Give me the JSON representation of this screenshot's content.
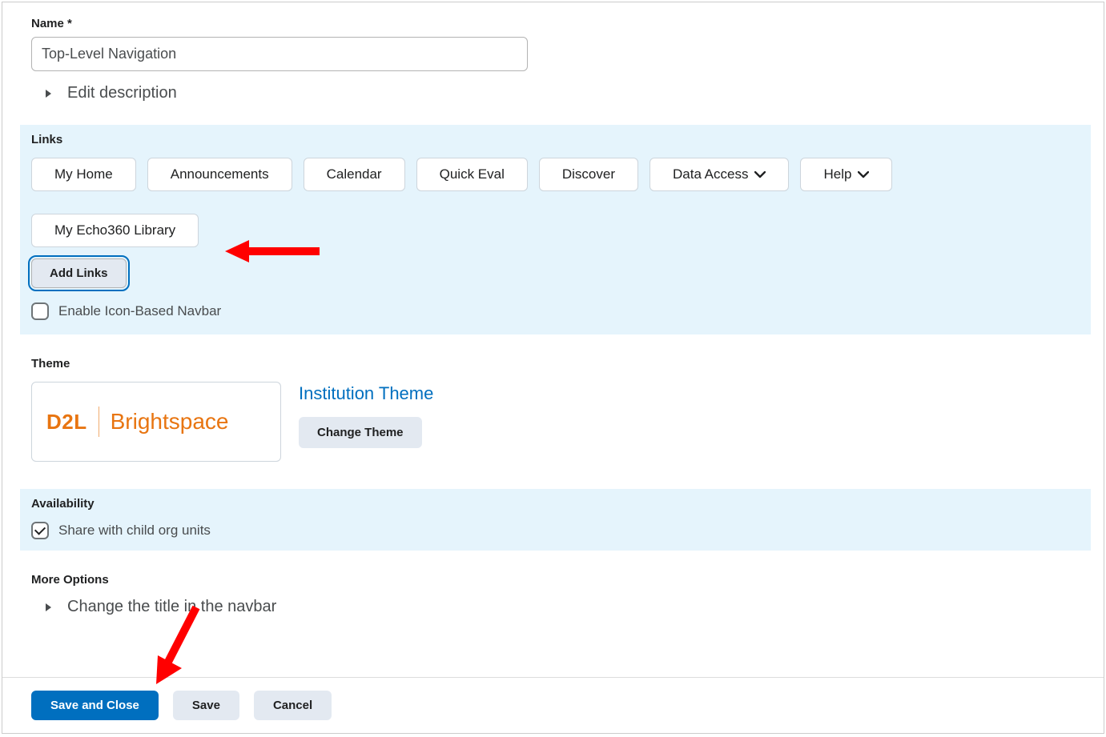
{
  "name": {
    "label": "Name *",
    "value": "Top-Level Navigation"
  },
  "editDescription": "Edit description",
  "links": {
    "heading": "Links",
    "items": [
      {
        "label": "My Home",
        "hasDropdown": false
      },
      {
        "label": "Announcements",
        "hasDropdown": false
      },
      {
        "label": "Calendar",
        "hasDropdown": false
      },
      {
        "label": "Quick Eval",
        "hasDropdown": false
      },
      {
        "label": "Discover",
        "hasDropdown": false
      },
      {
        "label": "Data Access",
        "hasDropdown": true
      },
      {
        "label": "Help",
        "hasDropdown": true
      },
      {
        "label": "My Echo360 Library",
        "hasDropdown": false
      }
    ],
    "addLinks": "Add Links",
    "enableIconNavbar": "Enable Icon-Based Navbar"
  },
  "theme": {
    "heading": "Theme",
    "logoLeft": "D2L",
    "logoRight": "Brightspace",
    "link": "Institution Theme",
    "changeTheme": "Change Theme"
  },
  "availability": {
    "heading": "Availability",
    "shareLabel": "Share with child org units"
  },
  "moreOptions": {
    "heading": "More Options",
    "changeTitle": "Change the title in the navbar"
  },
  "buttons": {
    "saveClose": "Save and Close",
    "save": "Save",
    "cancel": "Cancel"
  }
}
